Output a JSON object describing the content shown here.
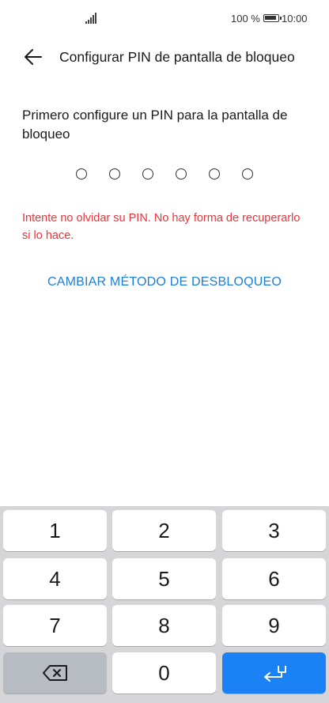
{
  "status_bar": {
    "battery_percent": "100 %",
    "time": "10:00",
    "signal_icon": "signal-bars-icon",
    "battery_icon": "battery-full-icon"
  },
  "header": {
    "back_icon": "arrow-left-icon",
    "title": "Configurar PIN de pantalla de bloqueo"
  },
  "content": {
    "instruction": "Primero configure un PIN para la pantalla de bloqueo",
    "pin_length": 6,
    "pin_entered": 0,
    "warning": "Intente no olvidar su PIN. No hay forma de recuperarlo si lo hace.",
    "change_method": "CAMBIAR MÉTODO DE DESBLOQUEO"
  },
  "keyboard": {
    "keys": [
      "1",
      "2",
      "3",
      "4",
      "5",
      "6",
      "7",
      "8",
      "9",
      "0"
    ],
    "backspace_icon": "backspace-icon",
    "enter_icon": "enter-icon"
  },
  "colors": {
    "accent": "#1a7fd6",
    "warning": "#e8353b",
    "enter_key": "#1a82f5",
    "keyboard_bg": "#d6d6d8"
  }
}
